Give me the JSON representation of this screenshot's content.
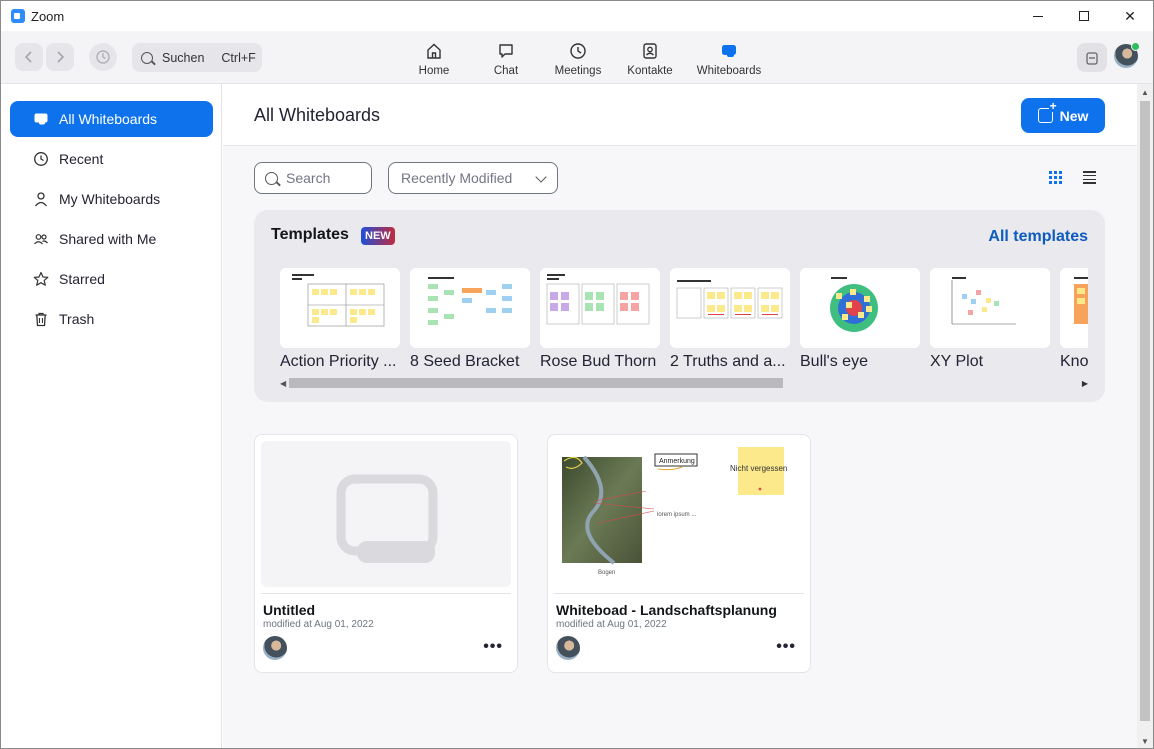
{
  "window": {
    "title": "Zoom",
    "minimize_icon": "minimize-icon",
    "maximize_icon": "maximize-icon",
    "close_glyph": "✕"
  },
  "toolbar": {
    "search_label": "Suchen",
    "search_shortcut": "Ctrl+F",
    "tabs": [
      {
        "label": "Home",
        "icon": "home-icon"
      },
      {
        "label": "Chat",
        "icon": "chat-icon"
      },
      {
        "label": "Meetings",
        "icon": "clock-icon"
      },
      {
        "label": "Kontakte",
        "icon": "contacts-icon"
      },
      {
        "label": "Whiteboards",
        "icon": "whiteboard-icon",
        "active": true
      }
    ]
  },
  "sidebar": {
    "items": [
      {
        "label": "All Whiteboards",
        "icon": "whiteboard-icon",
        "active": true
      },
      {
        "label": "Recent",
        "icon": "clock-icon"
      },
      {
        "label": "My Whiteboards",
        "icon": "person-icon"
      },
      {
        "label": "Shared with Me",
        "icon": "people-icon"
      },
      {
        "label": "Starred",
        "icon": "star-icon"
      },
      {
        "label": "Trash",
        "icon": "trash-icon"
      }
    ]
  },
  "main": {
    "title": "All Whiteboards",
    "new_button": "New",
    "search_placeholder": "Search",
    "sort_value": "Recently Modified",
    "templates": {
      "title": "Templates",
      "badge": "NEW",
      "all_link": "All templates",
      "items": [
        {
          "name": "Action Priority ..."
        },
        {
          "name": "8 Seed Bracket"
        },
        {
          "name": "Rose Bud Thorn"
        },
        {
          "name": "2 Truths and a..."
        },
        {
          "name": "Bull's eye"
        },
        {
          "name": "XY Plot"
        },
        {
          "name": "Kno"
        }
      ]
    },
    "whiteboards": [
      {
        "name": "Untitled",
        "modified": "modified at Aug 01, 2022"
      },
      {
        "name": "Whiteboad - Landschaftsplanung",
        "modified": "modified at Aug 01, 2022",
        "preview_note": "Nicht vergessen",
        "preview_label": "Anmerkung",
        "preview_text": "lorem ipsum ...",
        "preview_caption": "Bogen"
      }
    ]
  },
  "colors": {
    "accent": "#0e72ed",
    "link": "#0e5bbf",
    "sticky": "#fbe98c"
  }
}
